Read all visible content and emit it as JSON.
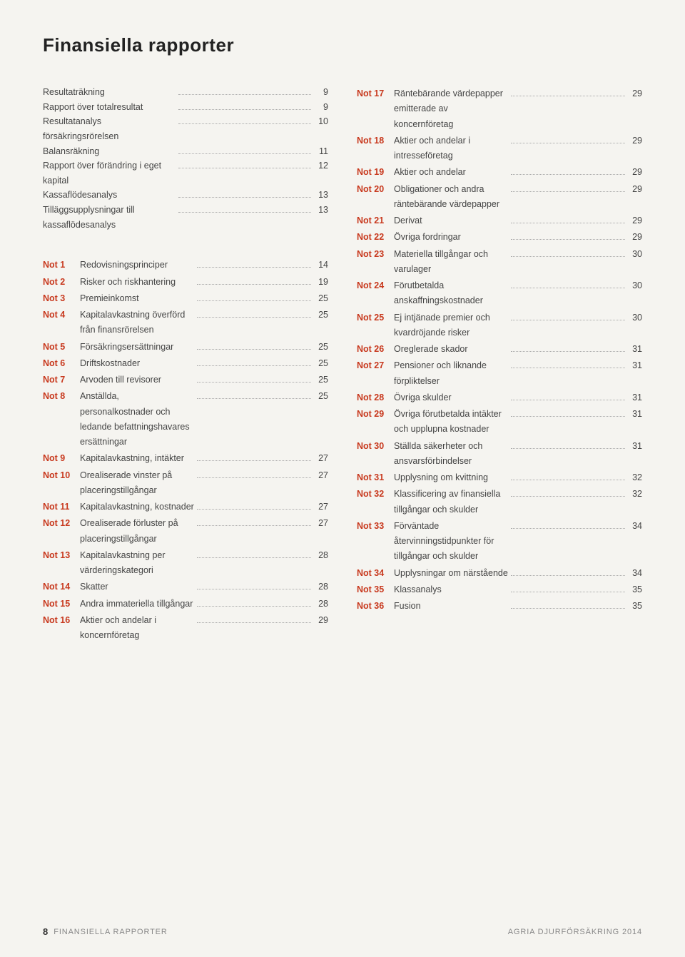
{
  "page": {
    "title": "Finansiella rapporter",
    "footer": {
      "page_number": "8",
      "section_name": "FINANSIELLA RAPPORTER",
      "brand": "AGRIA DJURFÖRSÄKRING 2014"
    }
  },
  "left_column": {
    "plain_rows": [
      {
        "label": "Resultaträkning",
        "dots": true,
        "page": "9"
      },
      {
        "label": "Rapport över totalresultat",
        "dots": true,
        "page": "9"
      },
      {
        "label": "Resultatanalys försäkringsrörelsen",
        "dots": true,
        "page": "10"
      },
      {
        "label": "Balansräkning",
        "dots": true,
        "page": "11"
      },
      {
        "label": "Rapport över förändring i eget kapital",
        "dots": true,
        "page": "12"
      },
      {
        "label": "Kassaflödesanalys",
        "dots": true,
        "page": "13"
      },
      {
        "label": "Tilläggsupplysningar till kassaflödesanalys",
        "dots": true,
        "page": "13"
      }
    ],
    "note_rows": [
      {
        "id": "Not 1",
        "label": "Redovisningsprinciper",
        "dots": true,
        "page": "14"
      },
      {
        "id": "Not 2",
        "label": "Risker och riskhantering",
        "dots": true,
        "page": "19"
      },
      {
        "id": "Not 3",
        "label": "Premieinkomst",
        "dots": true,
        "page": "25"
      },
      {
        "id": "Not 4",
        "label": "Kapitalavkastning överförd från finansrörelsen",
        "dots": true,
        "page": "25"
      },
      {
        "id": "Not 5",
        "label": "Försäkringsersättningar",
        "dots": true,
        "page": "25"
      },
      {
        "id": "Not 6",
        "label": "Driftskostnader",
        "dots": true,
        "page": "25"
      },
      {
        "id": "Not 7",
        "label": "Arvoden till revisorer",
        "dots": true,
        "page": "25"
      },
      {
        "id": "Not 8",
        "label": "Anställda, personalkostnader och ledande befattningshavares ersättningar",
        "dots": true,
        "page": "25"
      },
      {
        "id": "Not 9",
        "label": "Kapitalavkastning, intäkter",
        "dots": true,
        "page": "27"
      },
      {
        "id": "Not 10",
        "label": "Orealiserade vinster på placeringstillgångar",
        "dots": true,
        "page": "27"
      },
      {
        "id": "Not 11",
        "label": "Kapitalavkastning, kostnader",
        "dots": true,
        "page": "27"
      },
      {
        "id": "Not 12",
        "label": "Orealiserade förluster på placeringstillgångar",
        "dots": true,
        "page": "27"
      },
      {
        "id": "Not 13",
        "label": "Kapitalavkastning per värderingskategori",
        "dots": true,
        "page": "28"
      },
      {
        "id": "Not 14",
        "label": "Skatter",
        "dots": true,
        "page": "28"
      },
      {
        "id": "Not 15",
        "label": "Andra immateriella tillgångar",
        "dots": true,
        "page": "28"
      },
      {
        "id": "Not 16",
        "label": "Aktier och andelar i koncernföretag",
        "dots": true,
        "page": "29"
      }
    ]
  },
  "right_column": {
    "note_rows": [
      {
        "id": "Not 17",
        "label": "Räntebärande värdepapper emitterade av koncernföretag",
        "dots": true,
        "page": "29"
      },
      {
        "id": "Not 18",
        "label": "Aktier och andelar i intresseföretag",
        "dots": true,
        "page": "29"
      },
      {
        "id": "Not 19",
        "label": "Aktier och andelar",
        "dots": true,
        "page": "29"
      },
      {
        "id": "Not 20",
        "label": "Obligationer och andra räntebärande värdepapper",
        "dots": true,
        "page": "29"
      },
      {
        "id": "Not 21",
        "label": "Derivat",
        "dots": true,
        "page": "29"
      },
      {
        "id": "Not 22",
        "label": "Övriga fordringar",
        "dots": true,
        "page": "29"
      },
      {
        "id": "Not 23",
        "label": "Materiella tillgångar och varulager",
        "dots": true,
        "page": "30"
      },
      {
        "id": "Not 24",
        "label": "Förutbetalda anskaffningskostnader",
        "dots": true,
        "page": "30"
      },
      {
        "id": "Not 25",
        "label": "Ej intjänade premier och kvardröjande risker",
        "dots": true,
        "page": "30"
      },
      {
        "id": "Not 26",
        "label": "Oreglerade skador",
        "dots": true,
        "page": "31"
      },
      {
        "id": "Not 27",
        "label": "Pensioner och liknande förpliktelser",
        "dots": true,
        "page": "31"
      },
      {
        "id": "Not 28",
        "label": "Övriga skulder",
        "dots": true,
        "page": "31"
      },
      {
        "id": "Not 29",
        "label": "Övriga förutbetalda intäkter och upplupna kostnader",
        "dots": true,
        "page": "31"
      },
      {
        "id": "Not 30",
        "label": "Ställda säkerheter och ansvarsförbindelser",
        "dots": true,
        "page": "31"
      },
      {
        "id": "Not 31",
        "label": "Upplysning om kvittning",
        "dots": true,
        "page": "32"
      },
      {
        "id": "Not 32",
        "label": "Klassificering av finansiella tillgångar och skulder",
        "dots": true,
        "page": "32"
      },
      {
        "id": "Not 33",
        "label": "Förväntade återvinningstidpunkter för tillgångar och skulder",
        "dots": true,
        "page": "34"
      },
      {
        "id": "Not 34",
        "label": "Upplysningar om närstående",
        "dots": true,
        "page": "34"
      },
      {
        "id": "Not 35",
        "label": "Klassanalys",
        "dots": true,
        "page": "35"
      },
      {
        "id": "Not 36",
        "label": "Fusion",
        "dots": true,
        "page": "35"
      }
    ]
  }
}
